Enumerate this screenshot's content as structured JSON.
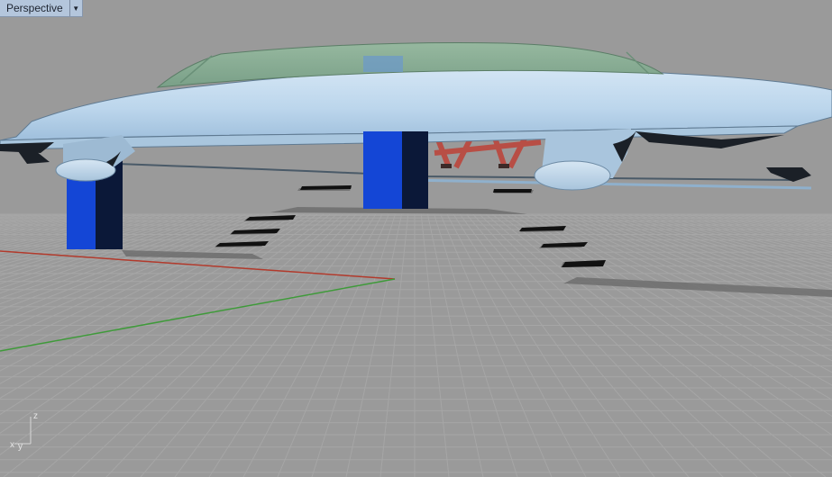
{
  "viewport": {
    "title": "Perspective",
    "menu_icon": "dropdown-arrow-icon"
  },
  "axis_widget": {
    "z_label": "z",
    "x_label": "x",
    "y_label": "y"
  },
  "colors": {
    "background": "#9a9a9a",
    "grid_line": "#a8a8a8",
    "x_axis": "#b23a2c",
    "y_axis": "#3f9a3a",
    "hull": "#bed7ec",
    "canopy": "#7fa58c",
    "support_column": "#1446d6",
    "table": "#c45a4e",
    "tab_background": "#b4c6dc"
  }
}
